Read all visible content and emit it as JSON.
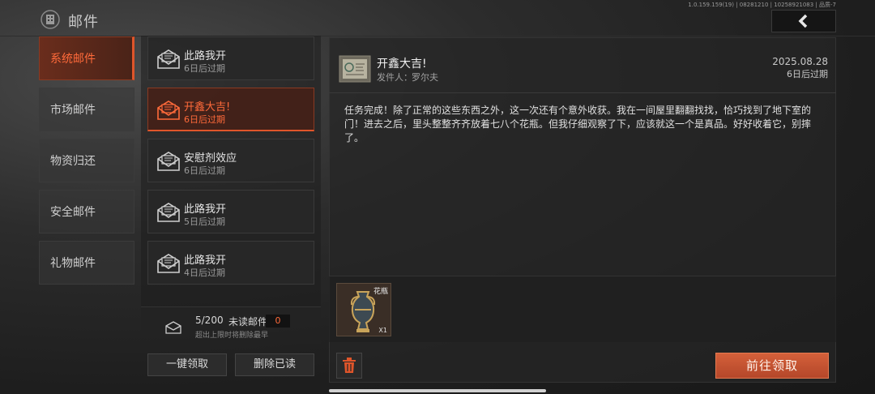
{
  "app": {
    "title": "邮件",
    "version_text": "1.0.159.159(19) | 08281210 | 10258921083 | 品质-7"
  },
  "nav": {
    "back_icon": "chevron-left-icon"
  },
  "categories": [
    {
      "label": "系统邮件",
      "active": true
    },
    {
      "label": "市场邮件",
      "active": false
    },
    {
      "label": "物资归还",
      "active": false
    },
    {
      "label": "安全邮件",
      "active": false
    },
    {
      "label": "礼物邮件",
      "active": false
    }
  ],
  "mails": [
    {
      "subject": "此路我开",
      "expire": "6日后过期",
      "active": false
    },
    {
      "subject": "开鑫大吉!",
      "expire": "6日后过期",
      "active": true
    },
    {
      "subject": "安慰剂效应",
      "expire": "6日后过期",
      "active": false
    },
    {
      "subject": "此路我开",
      "expire": "5日后过期",
      "active": false
    },
    {
      "subject": "此路我开",
      "expire": "4日后过期",
      "active": false
    }
  ],
  "stats": {
    "count": "5/200",
    "unread_label": "未读邮件",
    "unread_value": "0",
    "note": "超出上限时将删除最早"
  },
  "actions": {
    "claim_all": "一键领取",
    "delete_read": "删除已读"
  },
  "detail": {
    "title": "开鑫大吉!",
    "sender_label": "发件人：",
    "sender": "罗尔夫",
    "date": "2025.08.28",
    "expire": "6日后过期",
    "body": "任务完成！除了正常的这些东西之外，这一次还有个意外收获。我在一间屋里翻翻找找，恰巧找到了地下室的门！进去之后，里头整整齐齐放着七八个花瓶。但我仔细观察了下，应该就这一个是真品。好好收着它，别摔了。",
    "attachment": {
      "name": "花瓶",
      "qty": "X1",
      "icon": "vase-icon"
    },
    "claim_button": "前往领取",
    "delete_icon": "trash-icon"
  },
  "colors": {
    "accent": "#e0552a",
    "accent_text": "#ff6a3a",
    "claim_button": "#c5532f"
  }
}
